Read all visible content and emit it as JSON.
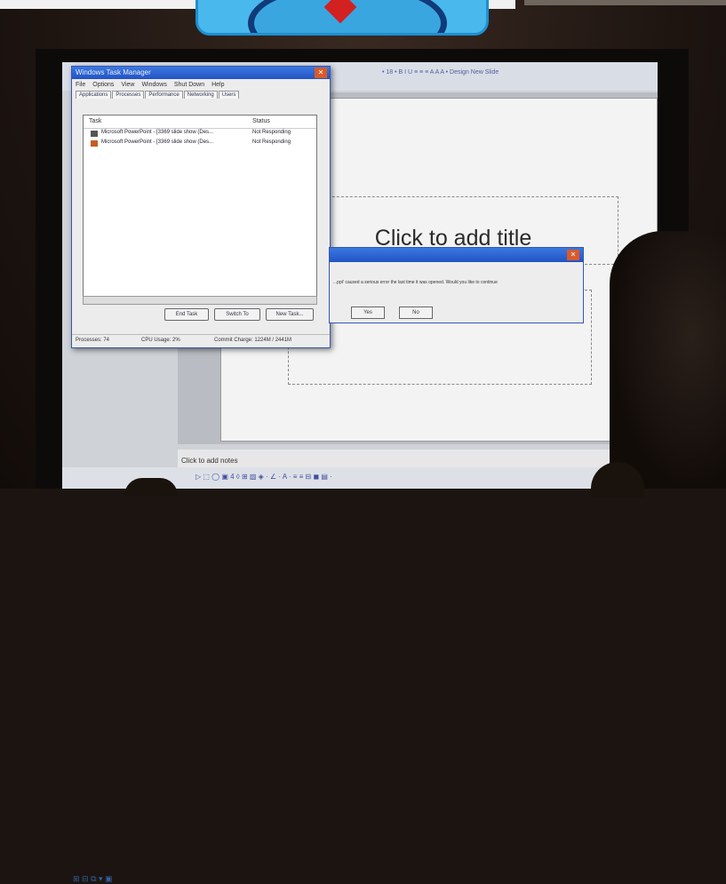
{
  "logo": {
    "colors": {
      "frame": "#1f8fd0",
      "fill": "#49b8ec",
      "ring": "#103a78",
      "accent": "#d32020"
    }
  },
  "task_manager": {
    "title": "Windows Task Manager",
    "menu": [
      "File",
      "Options",
      "View",
      "Windows",
      "Shut Down",
      "Help"
    ],
    "tabs": [
      "Applications",
      "Processes",
      "Performance",
      "Networking",
      "Users"
    ],
    "columns": {
      "task": "Task",
      "status": "Status"
    },
    "rows": [
      {
        "task": "Microsoft PowerPoint - [3369 slide show (Des...",
        "status": "Not Responding"
      },
      {
        "task": "Microsoft PowerPoint - [3369 slide show (Des...",
        "status": "Not Responding"
      }
    ],
    "buttons": {
      "end_task": "End Task",
      "switch_to": "Switch To",
      "new_task": "New Task..."
    },
    "status": {
      "processes": "Processes: 74",
      "cpu": "CPU Usage: 2%",
      "commit": "Commit Charge: 1224M / 2441M"
    }
  },
  "powerpoint": {
    "toolbar_text": "• 18 • B I U ≡ ≡ ≡ A A A • Design New Slide",
    "title_placeholder": "Click to add title",
    "notes_placeholder": "Click to add notes",
    "draw_toolbar_text": "▷ ⬚ ◯ ▣ 4 ◊ ⊞ ▨ ◈ · ∠ · A · ≡ ≡ ⊟ ◼ ▤ ·",
    "left_icons": "⊞ ⊟ ⧉ ▾ ▣"
  },
  "error_dialog": {
    "message": "...ppt' caused a serious error the last time it was opened. Would you like to continue",
    "buttons": {
      "yes": "Yes",
      "no": "No"
    }
  },
  "colors": {
    "titlebar": "#2253c4",
    "close": "#d85a2a"
  }
}
